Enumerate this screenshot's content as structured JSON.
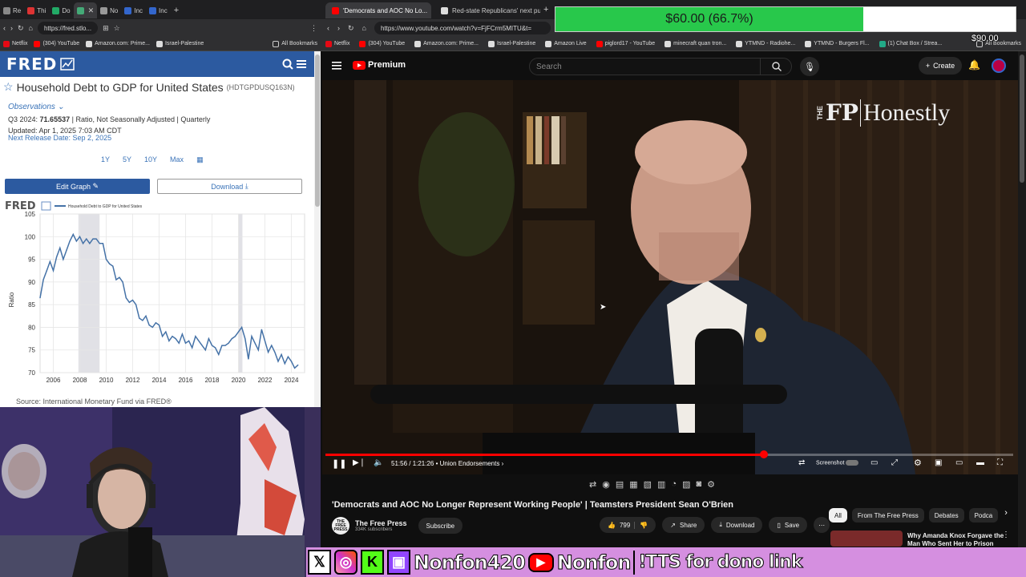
{
  "left_browser": {
    "tabs": [
      {
        "label": "Re",
        "color": "#888"
      },
      {
        "label": "Thi",
        "color": "#d33"
      },
      {
        "label": "Do",
        "color": "#2a6"
      },
      {
        "label": "",
        "color": "#4a7",
        "active": true
      },
      {
        "label": "No",
        "color": "#999"
      },
      {
        "label": "Inc",
        "color": "#36c"
      },
      {
        "label": "Inc",
        "color": "#36c"
      }
    ],
    "url": "https://fred.stlo...",
    "bookmarks": [
      "Netflix",
      "(304) YouTube",
      "Amazon.com: Prime...",
      "Israel-Palestine"
    ],
    "all_bookmarks": "All Bookmarks"
  },
  "fred": {
    "logo": "FRED",
    "series_title": "Household Debt to GDP for United States",
    "series_code": "(HDTGPDUSQ163N)",
    "observations_label": "Observations",
    "obs_period": "Q3 2024:",
    "obs_value": "71.65537",
    "obs_units": "| Ratio, Not Seasonally Adjusted | Quarterly",
    "updated": "Updated: Apr 1, 2025 7:03 AM CDT",
    "next_release": "Next Release Date: Sep 2, 2025",
    "ranges": [
      "1Y",
      "5Y",
      "10Y",
      "Max"
    ],
    "edit_graph": "Edit Graph",
    "download": "Download",
    "chart_logo": "FRED",
    "chart_legend": "Household Debt to GDP for United States",
    "source": "Source: International Monetary Fund via FRED®"
  },
  "chart_data": {
    "type": "line",
    "title": "Household Debt to GDP for United States",
    "xlabel": "",
    "ylabel": "Ratio",
    "ylim": [
      70,
      105
    ],
    "xlim": [
      2005,
      2025
    ],
    "y_ticks": [
      70,
      75,
      80,
      85,
      90,
      95,
      100,
      105
    ],
    "x_ticks": [
      2006,
      2008,
      2010,
      2012,
      2014,
      2016,
      2018,
      2020,
      2022,
      2024
    ],
    "grid": true,
    "recessions": [
      [
        2007.9,
        2009.5
      ],
      [
        2020.0,
        2020.3
      ]
    ],
    "series": [
      {
        "name": "Household Debt to GDP for United States",
        "color": "#4572a7",
        "x": [
          2005.0,
          2005.25,
          2005.5,
          2005.75,
          2006.0,
          2006.25,
          2006.5,
          2006.75,
          2007.0,
          2007.25,
          2007.5,
          2007.75,
          2008.0,
          2008.25,
          2008.5,
          2008.75,
          2009.0,
          2009.25,
          2009.5,
          2009.75,
          2010.0,
          2010.25,
          2010.5,
          2010.75,
          2011.0,
          2011.25,
          2011.5,
          2011.75,
          2012.0,
          2012.25,
          2012.5,
          2012.75,
          2013.0,
          2013.25,
          2013.5,
          2013.75,
          2014.0,
          2014.25,
          2014.5,
          2014.75,
          2015.0,
          2015.25,
          2015.5,
          2015.75,
          2016.0,
          2016.25,
          2016.5,
          2016.75,
          2017.0,
          2017.25,
          2017.5,
          2017.75,
          2018.0,
          2018.25,
          2018.5,
          2018.75,
          2019.0,
          2019.25,
          2019.5,
          2019.75,
          2020.0,
          2020.25,
          2020.5,
          2020.75,
          2021.0,
          2021.25,
          2021.5,
          2021.75,
          2022.0,
          2022.25,
          2022.5,
          2022.75,
          2023.0,
          2023.25,
          2023.5,
          2023.75,
          2024.0,
          2024.25,
          2024.5
        ],
        "values": [
          86.5,
          90.5,
          92.5,
          94.5,
          92.5,
          95.5,
          97.5,
          95.0,
          97.0,
          99.0,
          100.5,
          99.0,
          100.0,
          98.5,
          99.5,
          98.5,
          99.5,
          99.5,
          98.5,
          98.5,
          95.0,
          94.0,
          93.5,
          90.5,
          91.0,
          90.0,
          86.5,
          85.5,
          86.0,
          85.0,
          82.0,
          81.5,
          82.5,
          80.5,
          80.0,
          81.0,
          80.5,
          78.0,
          79.0,
          77.0,
          78.0,
          77.5,
          76.5,
          78.5,
          76.5,
          77.0,
          75.5,
          78.0,
          77.0,
          76.0,
          75.0,
          77.5,
          76.0,
          75.5,
          74.0,
          76.0,
          76.0,
          76.5,
          77.5,
          78.0,
          79.0,
          80.0,
          77.5,
          73.0,
          78.0,
          76.5,
          75.0,
          79.5,
          77.0,
          74.5,
          76.0,
          74.5,
          72.5,
          74.0,
          72.0,
          73.5,
          72.5,
          71.0,
          71.7
        ]
      }
    ]
  },
  "right_browser": {
    "tabs": [
      {
        "label": "'Democrats and AOC No Lo...",
        "color": "#f00",
        "active": true
      },
      {
        "label": "Red-state Republicans' next pu...",
        "color": "#ddd"
      }
    ],
    "url": "https://www.youtube.com/watch?v=FjFCrm5MITU&t=",
    "bookmarks": [
      "Netflix",
      "(304) YouTube",
      "Amazon.com: Prime...",
      "Israel-Palestine",
      "Amazon Live",
      "piglord17 - YouTube",
      "minecraft quan tron...",
      "YTMND - Radiohe...",
      "YTMND - Burgers Fl...",
      "(1) Chat Box / Strea..."
    ],
    "all_bookmarks": "All Bookmarks"
  },
  "youtube": {
    "logo": "Premium",
    "search_placeholder": "Search",
    "create": "Create",
    "watermark_the": "THE",
    "watermark_fp": "FP",
    "watermark_show": "Honestly",
    "time": "51:56 / 1:21:26",
    "chapter": "Union Endorsements",
    "progress_fraction": 0.638,
    "screenshot_label": "Screenshot",
    "video_title": "'Democrats and AOC No Longer Represent Working People' | Teamsters President Sean O'Brien",
    "channel_name": "The Free Press",
    "channel_avatar_text": "THE FREE PRESS",
    "subscribers": "334K subscribers",
    "subscribe": "Subscribe",
    "likes": "799",
    "share": "Share",
    "download": "Download",
    "save": "Save",
    "chips": [
      "All",
      "From The Free Press",
      "Debates",
      "Podca"
    ],
    "suggested_title_line1": "Why Amanda Knox Forgave the",
    "suggested_title_line2": "Man Who Sent Her to Prison"
  },
  "overlay": {
    "dono_text": "$60.00 (66.7%)",
    "dono_fraction": 0.667,
    "dono_goal": "$90.00",
    "social_handle": "Nonfon420",
    "youtube_handle": "Nonfon",
    "tts_text": "!TTS for dono link",
    "colors": {
      "bar": "#d58fe0",
      "dono_fill": "#28c84b"
    }
  }
}
